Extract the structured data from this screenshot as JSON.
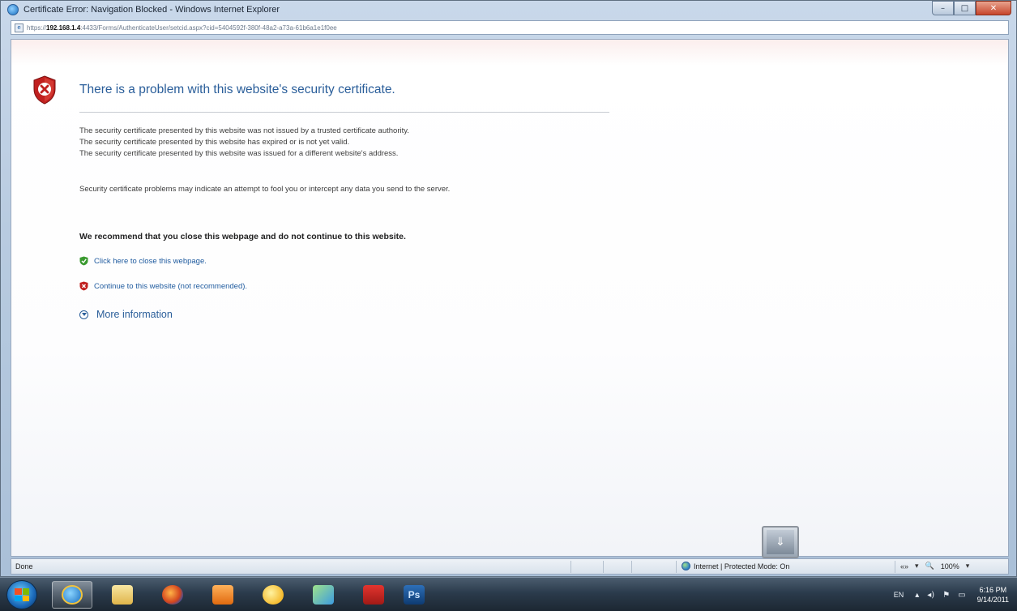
{
  "window": {
    "title": "Certificate Error: Navigation Blocked - Windows Internet Explorer",
    "minimize_label": "–",
    "maximize_label": "□",
    "close_label": "✕"
  },
  "address": {
    "url_prefix": "https://",
    "url_host": "192.168.1.4",
    "url_rest": ":4433/Forms/AuthenticateUser/setcid.aspx?cid=5404592f-380f-48a2-a73a-61b6a1e1f0ee"
  },
  "page": {
    "heading": "There is a problem with this website's security certificate.",
    "reasons": [
      "The security certificate presented by this website was not issued by a trusted certificate authority.",
      "The security certificate presented by this website has expired or is not yet valid.",
      "The security certificate presented by this website was issued for a different website's address."
    ],
    "warning": "Security certificate problems may indicate an attempt to fool you or intercept any data you send to the server.",
    "recommendation": "We recommend that you close this webpage and do not continue to this website.",
    "close_link": "Click here to close this webpage.",
    "continue_link": "Continue to this website (not recommended).",
    "more_info": "More information",
    "colors": {
      "heading": "#2a5e9a",
      "link": "#1f5b9e",
      "shield_red": "#c0201f",
      "shield_green": "#3a9a2f"
    }
  },
  "statusbar": {
    "status": "Done",
    "zone": "Internet | Protected Mode: On",
    "zoom": "100%",
    "zoom_arrow": "▾",
    "tools_icon": "«»",
    "zoom_icon": "🔍"
  },
  "taskbar": {
    "items": [
      "start",
      "internet-explorer",
      "windows-explorer",
      "firefox",
      "media-player",
      "messenger",
      "live-messenger",
      "adobe-reader",
      "photoshop"
    ],
    "photoshop_label": "Ps",
    "language": "EN",
    "time": "6:16 PM",
    "date": "9/14/2011"
  }
}
